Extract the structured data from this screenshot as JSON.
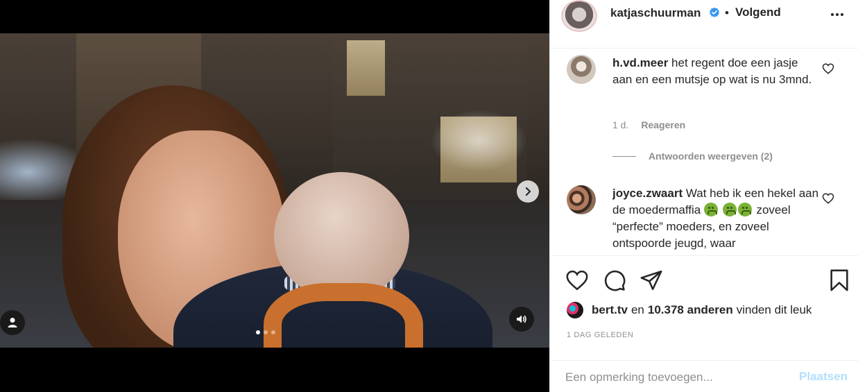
{
  "post": {
    "author": "katjaschuurman",
    "follow_state": "Volgend",
    "separator": "•",
    "media": {
      "carousel_dots": 3,
      "active_dot": 0
    }
  },
  "comments": [
    {
      "username": "h.vd.meer",
      "text": "het regent doe een jasje aan en een mutsje op wat is nu 3mnd.",
      "age": "1 d.",
      "reply_label": "Reageren",
      "view_replies": "Antwoorden weergeven (2)"
    },
    {
      "username": "joyce.zwaart",
      "text_part1": "Wat heb ik een hekel aan de moedermaffia",
      "text_part2": "zoveel “perfecte” moeders, en zoveel ontspoorde jeugd, waar"
    }
  ],
  "likes": {
    "user": "bert.tv",
    "connector": "en",
    "count": "10.378 anderen",
    "suffix": "vinden dit leuk"
  },
  "timestamp": "1 dag geleden",
  "add_comment": {
    "placeholder": "Een opmerking toevoegen...",
    "submit_label": "Plaatsen"
  },
  "colors": {
    "verified": "#3897f0",
    "post_disabled": "#b2dffc",
    "secondary_text": "#8e8e8e"
  },
  "icons": {
    "like": "heart-icon",
    "comment": "comment-icon",
    "share": "share-icon",
    "save": "bookmark-icon",
    "next": "chevron-right-icon",
    "user_tag": "user-icon",
    "audio": "volume-icon"
  }
}
